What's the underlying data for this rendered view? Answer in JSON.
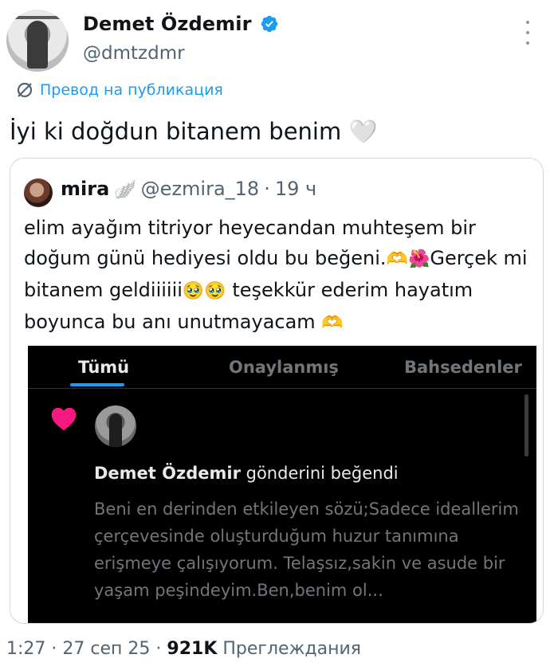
{
  "author": {
    "name": "Demet Özdemir",
    "handle": "@dmtzdmr",
    "verified_color": "#1d9bf0"
  },
  "translate": {
    "label": "Превод на публикация",
    "icon": "translate-icon"
  },
  "tweet": {
    "text": "İyi ki doğdun bitanem benim",
    "emoji": "🤍"
  },
  "quote": {
    "name": "mira",
    "name_emoji": "🪽",
    "handle": "@ezmira_18",
    "dot": "·",
    "time": "19 ч",
    "text_part1": "elim ayağım titriyor  heyecandan muhteşem bir doğum günü hediyesi oldu bu beğeni.",
    "emoji1": "🫶",
    "emoji2": "🌺",
    "text_part2": "Gerçek mi bitanem geldiiiiii",
    "emoji3": "🥹",
    "emoji4": "🥹",
    "text_part3": " teşekkür ederim hayatım boyunca bu anı unutmayacam ",
    "emoji5": "🫶",
    "screenshot": {
      "tabs": [
        "Tümü",
        "Onaylanmış",
        "Bahsedenler"
      ],
      "active_tab": "Tümü",
      "accent": "#1d9bf0",
      "notification": {
        "name": "Demet Özdemir",
        "action": "gönderini beğendi",
        "text": "Beni en derinden etkileyen sözü;Sadece ideallerim çerçevesinde oluşturduğum huzur tanımına erişmeye çalışıyorum. Telaşsız,sakin ve asude bir yaşam peşindeyim.Ben,benim ol...",
        "heart_color": "#f91880"
      }
    }
  },
  "meta": {
    "time": "1:27",
    "dot1": "·",
    "date": "27 сеп 25",
    "dot2": "·",
    "views_count": "921K",
    "views_label": "Преглеждания"
  }
}
